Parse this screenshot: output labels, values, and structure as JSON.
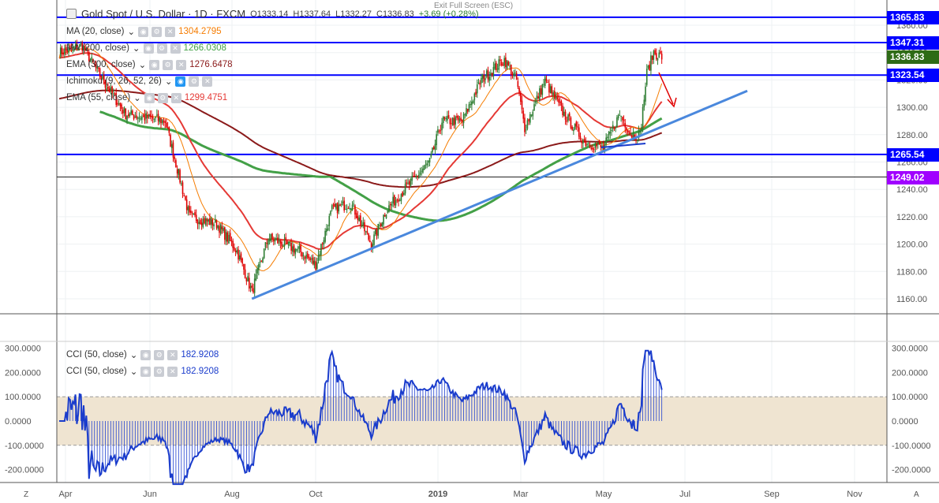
{
  "header": {
    "title": "Gold Spot / U.S. Dollar · 1D · FXCM",
    "open": "O1333.14",
    "high": "H1337.64",
    "low": "L1332.27",
    "close": "C1336.83",
    "change": "+3.69 (+0.28%)",
    "exit_full_screen": "Exit Full Screen (ESC)"
  },
  "legend": [
    {
      "label": "MA (20, close)",
      "value": "1304.2795",
      "color": "#f57c00"
    },
    {
      "label": "MA (200, close)",
      "value": "1266.0308",
      "color": "#43a047"
    },
    {
      "label": "EMA (300, close)",
      "value": "1276.6478",
      "color": "#8b1a1a"
    },
    {
      "label": "Ichimoku (9, 26, 52, 26)",
      "value": "",
      "color": "#999"
    },
    {
      "label": "EMA (55, close)",
      "value": "1299.4751",
      "color": "#e53935"
    }
  ],
  "cci_legend": [
    {
      "label": "CCI (50, close)",
      "value": "182.9208"
    },
    {
      "label": "CCI (50, close)",
      "value": "182.9208"
    }
  ],
  "price_labels": [
    {
      "value": "1365.83",
      "color": "#0000ff"
    },
    {
      "value": "1347.31",
      "color": "#0000ff"
    },
    {
      "value": "1336.83",
      "color": "#2e6b16"
    },
    {
      "value": "1323.54",
      "color": "#0000ff"
    },
    {
      "value": "1265.54",
      "color": "#0000ff"
    },
    {
      "value": "1249.02",
      "color": "#a000ff"
    }
  ],
  "bottom": {
    "left_btn": "Z",
    "right_btn": "A"
  },
  "chart_data": {
    "type": "candlestick",
    "price_axis": {
      "ticks": [
        1360,
        1340,
        1320,
        1300,
        1280,
        1260,
        1240,
        1220,
        1200,
        1180,
        1160
      ],
      "range": [
        1142,
        1376
      ]
    },
    "cci_axis": {
      "ticks": [
        "300.0000",
        "200.0000",
        "100.0000",
        "0.0000",
        "-100.0000",
        "-200.0000"
      ],
      "band": [
        -100,
        100
      ]
    },
    "x_ticks": [
      "Apr",
      "Jun",
      "Aug",
      "Oct",
      "2019",
      "Mar",
      "May",
      "Jul",
      "Sep",
      "Nov"
    ],
    "horizontal_levels": [
      1365.83,
      1347.31,
      1323.54,
      1265.54,
      1249.02
    ],
    "trendline": {
      "from": [
        142,
        1160
      ],
      "to": [
        507,
        1312
      ]
    },
    "close_path_days": [
      0,
      17,
      32,
      49,
      78,
      96,
      116,
      131,
      142,
      154,
      177,
      189,
      201,
      215,
      230,
      241,
      259,
      273,
      282,
      297,
      311,
      328,
      337,
      343,
      358,
      363,
      372,
      387,
      401,
      413,
      422,
      428,
      433,
      438,
      444
    ],
    "close_path_prices": [
      1340,
      1345,
      1320,
      1295,
      1290,
      1220,
      1215,
      1195,
      1165,
      1205,
      1195,
      1185,
      1225,
      1230,
      1200,
      1225,
      1245,
      1260,
      1290,
      1290,
      1320,
      1335,
      1320,
      1285,
      1320,
      1310,
      1295,
      1275,
      1270,
      1295,
      1280,
      1280,
      1325,
      1340,
      1337
    ]
  }
}
